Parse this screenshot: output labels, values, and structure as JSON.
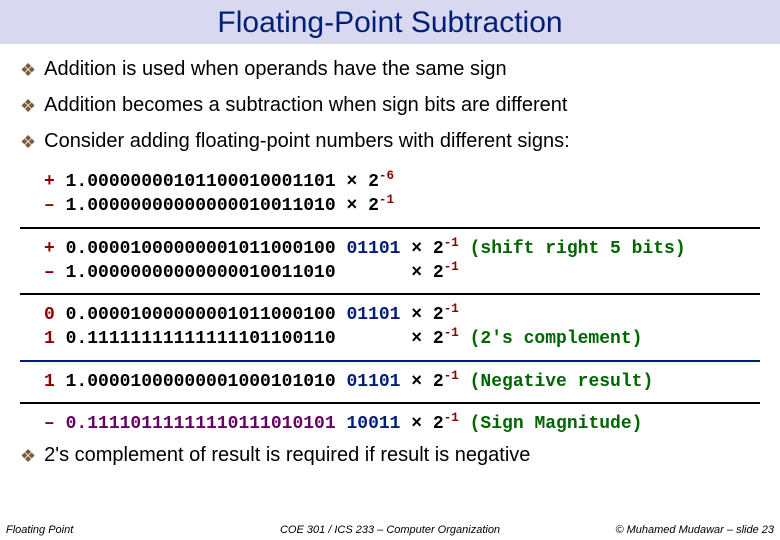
{
  "title": "Floating-Point Subtraction",
  "bullets": {
    "b1": "Addition is used when operands have the same sign",
    "b2": "Addition becomes a subtraction when sign bits are different",
    "b3": "Consider adding floating-point numbers with different signs:",
    "b4": "2's complement of result is required if result is negative"
  },
  "lines": {
    "l1_sign": "+ ",
    "l1_mant": "1.00000000101100010001101 ",
    "l1_mul": "× ",
    "l1_base": "2",
    "l1_exp": "-6",
    "l2_sign": "– ",
    "l2_mant": "1.00000000000000010011010 ",
    "l2_mul": "× ",
    "l2_base": "2",
    "l2_exp": "-1",
    "l3_sign": "+ ",
    "l3_mant": "0.00001000000001011000100 ",
    "l3_extra": "01101 ",
    "l3_mul": "× ",
    "l3_base": "2",
    "l3_exp": "-1",
    "l3_note": " (shift right 5 bits)",
    "l4_sign": "– ",
    "l4_mant": "1.00000000000000010011010       ",
    "l4_mul": "× ",
    "l4_base": "2",
    "l4_exp": "-1",
    "l5_sign": "0 ",
    "l5_mant": "0.00001000000001011000100 ",
    "l5_extra": "01101 ",
    "l5_mul": "× ",
    "l5_base": "2",
    "l5_exp": "-1",
    "l6_sign": "1 ",
    "l6_mant": "0.11111111111111101100110       ",
    "l6_mul": "× ",
    "l6_base": "2",
    "l6_exp": "-1",
    "l6_note": " (2's complement)",
    "l7_sign": "1 ",
    "l7_mant": "1.00001000000001000101010 ",
    "l7_extra": "01101 ",
    "l7_mul": "× ",
    "l7_base": "2",
    "l7_exp": "-1",
    "l7_note": " (Negative result)",
    "l8_sign": "– ",
    "l8_mant": "0.11110111111110111010101 ",
    "l8_extra": "10011 ",
    "l8_mul": "× ",
    "l8_base": "2",
    "l8_exp": "-1",
    "l8_note": " (Sign Magnitude)"
  },
  "footer": {
    "left": "Floating Point",
    "center": "COE 301 / ICS 233 – Computer Organization",
    "right": "© Muhamed Mudawar – slide 23"
  }
}
